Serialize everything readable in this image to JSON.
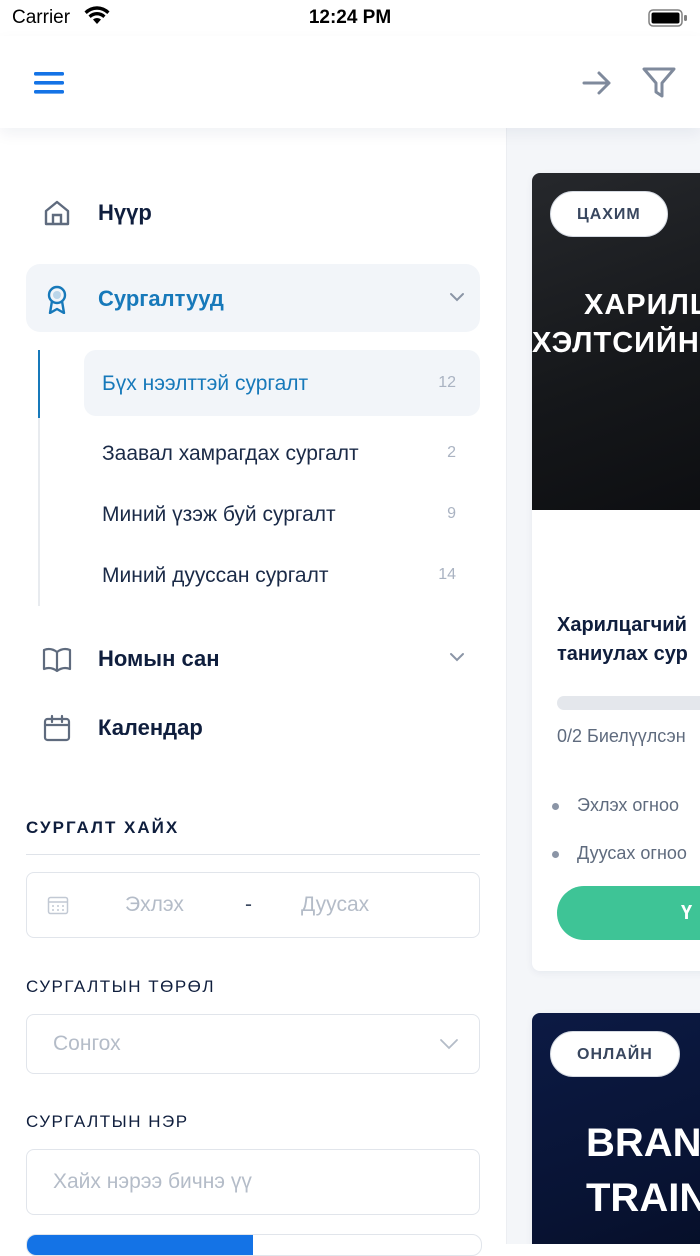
{
  "status_bar": {
    "carrier": "Carrier",
    "time": "12:24 PM"
  },
  "header": {
    "menu_icon": "hamburger-menu-icon",
    "arrow_icon": "arrow-right-icon",
    "filter_icon": "filter-icon"
  },
  "sidebar": {
    "nav": [
      {
        "label": "Нүүр",
        "icon": "home-icon"
      },
      {
        "label": "Сургалтууд",
        "icon": "award-icon"
      },
      {
        "label": "Номын сан",
        "icon": "book-icon"
      },
      {
        "label": "Календар",
        "icon": "calendar-icon"
      }
    ],
    "sub_items": [
      {
        "label": "Бүх нээлттэй сургалт",
        "count": "12"
      },
      {
        "label": "Заавал хамрагдах сургалт",
        "count": "2"
      },
      {
        "label": "Миний үзэж буй сургалт",
        "count": "9"
      },
      {
        "label": "Миний дууссан сургалт",
        "count": "14"
      }
    ],
    "search_title": "СУРГАЛТ ХАЙХ",
    "date_start": "Эхлэх",
    "date_sep": "-",
    "date_end": "Дуусах",
    "type_label": "СУРГАЛТЫН ТӨРӨЛ",
    "type_placeholder": "Сонгох",
    "name_label": "СУРГАЛТЫН НЭР",
    "name_placeholder": "Хайх нэрээ бичнэ үү"
  },
  "cards": [
    {
      "badge": "ЦАХИМ",
      "thumb_line1": "ХАРИЛЦ",
      "thumb_line2": "ХЭЛТСИЙН",
      "title_line1": "Харилцагчий",
      "title_line2": "таниулах сур",
      "progress_fraction": 0,
      "progress_text": "0/2 Биелүүлсэн",
      "bullet1": "Эхлэх огноо",
      "bullet2": "Дуусах огноо",
      "button": "Ү"
    },
    {
      "badge": "ОНЛАЙН",
      "thumb_line1": "BRAND",
      "thumb_line2": "TRAINI"
    }
  ]
}
